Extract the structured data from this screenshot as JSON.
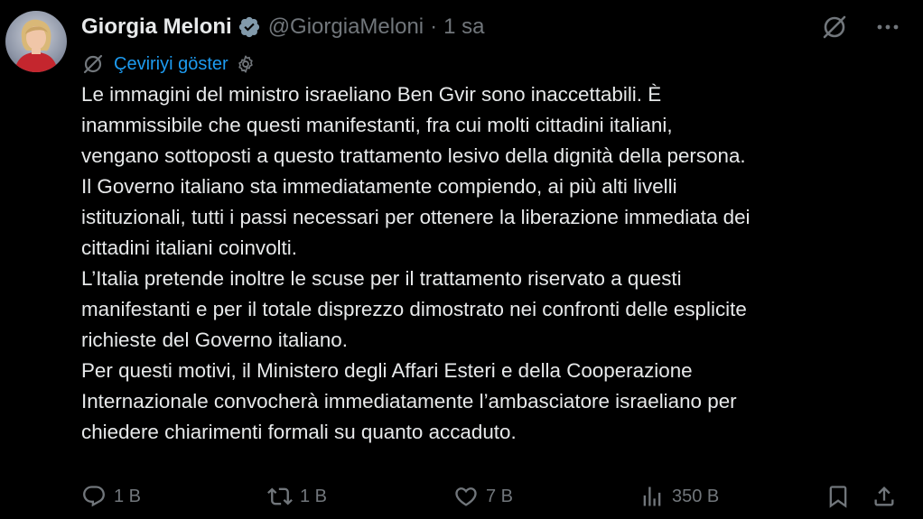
{
  "author": {
    "display_name": "Giorgia Meloni",
    "handle": "@GiorgiaMeloni",
    "separator": "·",
    "time": "1 sa",
    "verified": true,
    "verified_color": "#829aab"
  },
  "translate": {
    "label": "Çeviriyi göster",
    "link_color": "#1d9bf0"
  },
  "post": {
    "lines": [
      "Le immagini del ministro israeliano Ben Gvir sono inaccettabili. È",
      "inammissibile che questi manifestanti, fra cui molti cittadini italiani,",
      "vengano sottoposti a questo trattamento lesivo della dignità della persona.",
      "Il Governo italiano sta immediatamente compiendo, ai più alti livelli",
      "istituzionali, tutti i passi necessari per ottenere la liberazione immediata dei",
      "cittadini italiani coinvolti.",
      "L’Italia pretende inoltre le scuse per il trattamento riservato a questi",
      "manifestanti e per il totale disprezzo dimostrato nei confronti delle esplicite",
      "richieste del Governo italiano.",
      "Per questi motivi, il Ministero degli Affari Esteri e della Cooperazione",
      "Internazionale convocherà immediatamente l’ambasciatore israeliano per",
      "chiedere chiarimenti formali su quanto accaduto."
    ]
  },
  "metrics": {
    "replies": "1 B",
    "reposts": "1 B",
    "likes": "7 B",
    "views": "350 B"
  },
  "icons": {
    "verified": "verified-badge-icon",
    "grok": "grok-icon",
    "more": "more-icon",
    "translate": "grok-translate-icon",
    "settings": "gear-icon",
    "reply": "reply-icon",
    "repost": "repost-icon",
    "like": "heart-icon",
    "views": "views-icon",
    "bookmark": "bookmark-icon",
    "share": "share-icon"
  },
  "colors": {
    "background": "#000000",
    "text": "#e7e9ea",
    "secondary": "#71767b"
  }
}
